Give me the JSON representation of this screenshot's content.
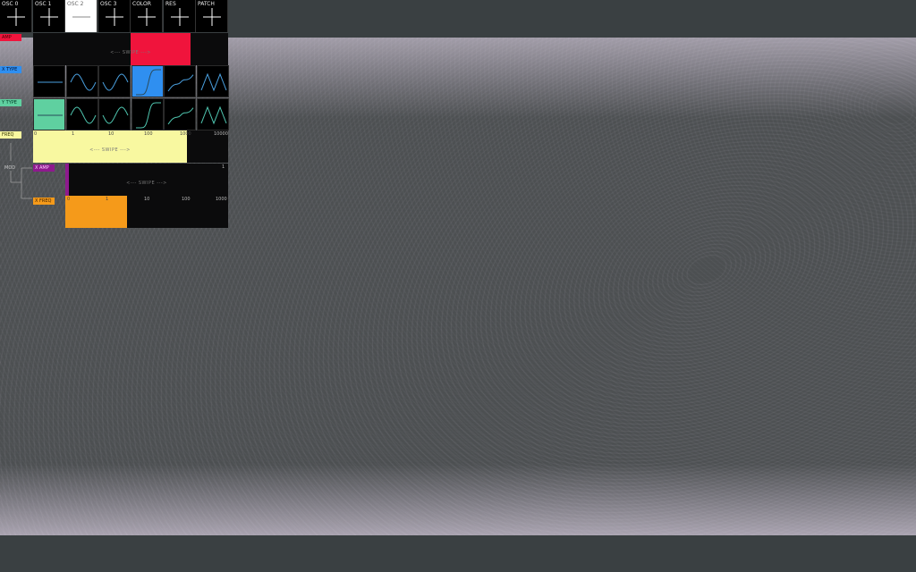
{
  "tabs": [
    {
      "label": "OSC 0",
      "icon": "plus-icon",
      "active": false
    },
    {
      "label": "OSC 1",
      "icon": "plus-icon",
      "active": false
    },
    {
      "label": "OSC 2",
      "icon": "minus-icon",
      "active": true
    },
    {
      "label": "OSC 3",
      "icon": "plus-icon",
      "active": false
    },
    {
      "label": "COLOR",
      "icon": "plus-icon",
      "active": false
    },
    {
      "label": "RES",
      "icon": "plus-icon",
      "active": false
    },
    {
      "label": "PATCH",
      "icon": "plus-icon",
      "active": false
    }
  ],
  "controls": {
    "amp": {
      "label": "AMP",
      "swipe": "<--- SWIPE --->",
      "color": "#f0143c"
    },
    "x_type": {
      "label": "X TYPE",
      "color": "#2f8ff0",
      "selected_index": 3
    },
    "y_type": {
      "label": "Y TYPE",
      "color": "#5fd0a0",
      "selected_index": 0
    },
    "freq": {
      "label": "FREQ",
      "swipe": "<--- SWIPE --->",
      "color": "#f8f8a0",
      "ticks": [
        "0",
        "1",
        "10",
        "100",
        "1000",
        "10000"
      ]
    },
    "mod_label": "MOD",
    "x_amp": {
      "label": "X AMP",
      "swipe": "<--- SWIPE --->",
      "color": "#8e1a8e",
      "right_tick": "1"
    },
    "x_freq": {
      "label": "X FREQ",
      "color": "#f59a1a",
      "ticks": [
        "0",
        "1",
        "10",
        "100",
        "1000"
      ]
    }
  },
  "wave_icons": [
    "line-wave-icon",
    "sine-wave-icon",
    "inverted-sine-wave-icon",
    "tangent-wave-icon",
    "cotangent-wave-icon",
    "triangle-wave-icon"
  ],
  "colors": {
    "background": "#3a4042",
    "visualizer": "#e8dcf0",
    "wave_stroke": "#4fc6b0"
  }
}
